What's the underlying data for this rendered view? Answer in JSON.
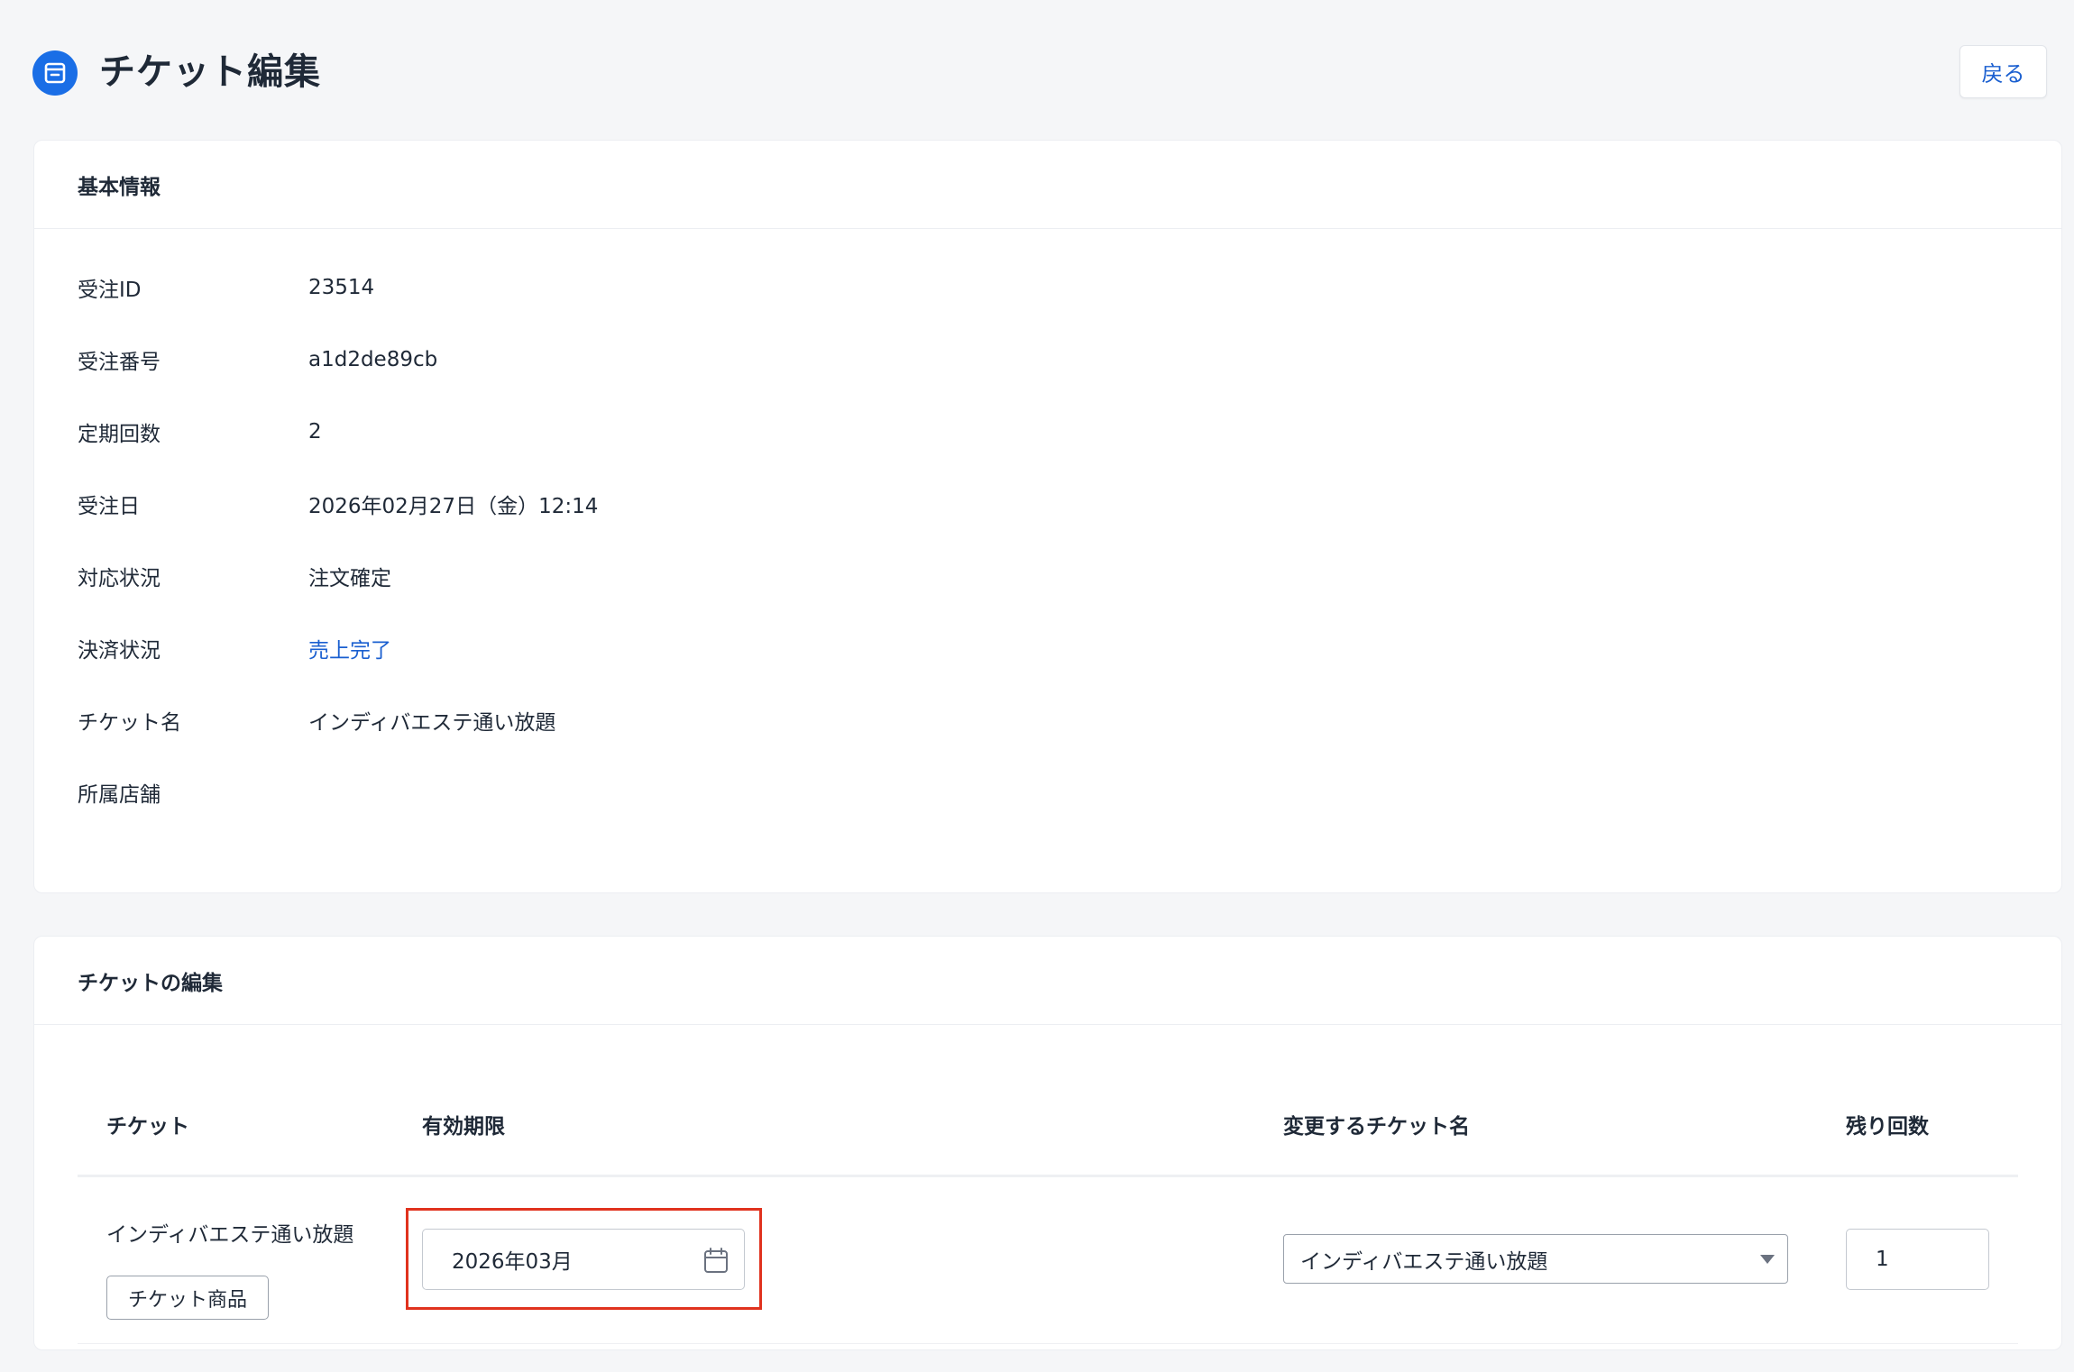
{
  "header": {
    "title": "チケット編集",
    "back_label": "戻る"
  },
  "basic_info": {
    "title": "基本情報",
    "rows": [
      {
        "label": "受注ID",
        "value": "23514"
      },
      {
        "label": "受注番号",
        "value": "a1d2de89cb"
      },
      {
        "label": "定期回数",
        "value": "2"
      },
      {
        "label": "受注日",
        "value": "2026年02月27日（金）12:14"
      },
      {
        "label": "対応状況",
        "value": "注文確定"
      },
      {
        "label": "決済状況",
        "value": "売上完了"
      },
      {
        "label": "チケット名",
        "value": "インディバエステ通い放題"
      },
      {
        "label": "所属店舗",
        "value": ""
      }
    ]
  },
  "ticket_edit": {
    "title": "チケットの編集",
    "columns": {
      "ticket": "チケット",
      "expiry": "有効期限",
      "new_name": "変更するチケット名",
      "remaining": "残り回数"
    },
    "row": {
      "ticket_name": "インディバエステ通い放題",
      "ticket_badge": "チケット商品",
      "expiry_value": "2026年03月",
      "selected_ticket_name": "インディバエステ通い放題",
      "remaining_count": "1"
    }
  },
  "colors": {
    "accent": "#1a6ee6",
    "link": "#1a5fd0",
    "highlight": "#e0321e"
  }
}
